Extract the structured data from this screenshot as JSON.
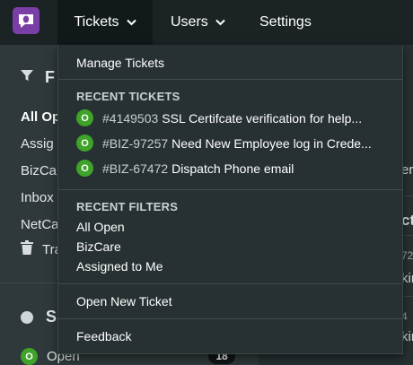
{
  "nav": {
    "tickets_label": "Tickets",
    "users_label": "Users",
    "settings_label": "Settings"
  },
  "left_panel": {
    "filters_header": "F",
    "items": [
      "All Op",
      "Assig",
      "BizCa",
      "Inbox",
      "NetCa"
    ],
    "trash_label": "Tra",
    "status_header": "S",
    "open_badge": "O",
    "open_label": "Open",
    "open_count": "18"
  },
  "right_panel": {
    "fragment_1": "er",
    "fragment_2": "ct",
    "fragment_3": "72",
    "fragment_4": "kin",
    "fragment_5": "4",
    "fragment_6": "kin"
  },
  "dropdown": {
    "manage_tickets": "Manage Tickets",
    "recent_tickets_header": "RECENT TICKETS",
    "recent_tickets": [
      {
        "badge": "O",
        "id": "#4149503",
        "title": "SSL Certifcate verification for help..."
      },
      {
        "badge": "O",
        "id": "#BIZ-97257",
        "title": "Need New Employee log in Crede..."
      },
      {
        "badge": "O",
        "id": "#BIZ-67472",
        "title": "Dispatch Phone email"
      }
    ],
    "recent_filters_header": "RECENT FILTERS",
    "recent_filters": [
      "All Open",
      "BizCare",
      "Assigned to Me"
    ],
    "open_new_ticket": "Open New Ticket",
    "feedback": "Feedback"
  },
  "colors": {
    "accent_purple": "#7a3fa6",
    "open_green": "#3fa329",
    "nav_bg": "#1b2325",
    "menu_bg": "#273133"
  }
}
